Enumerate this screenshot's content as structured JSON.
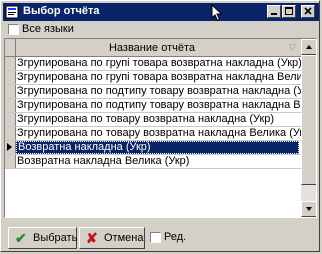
{
  "window": {
    "title": "Выбор отчёта",
    "title_color": "#0a246a"
  },
  "options": {
    "all_languages_label": "Все языки",
    "all_languages_checked": false
  },
  "grid": {
    "column_header": "Название отчёта",
    "rows": [
      "Згрупирована по групі товара возвратна накладна (Укр)",
      "Згрупирована по групі товара возвратна накладна Велика (Укр)",
      "Згрупирована по подтипу товару возвратна накладна (Укр)",
      "Згрупирована по подтипу товару возвратна накладна Велика (Укр)",
      "Згрупирована по товару возвратна накладна (Укр)",
      "Згрупирована по товару возвратна накладна Велика (Укр)",
      "Возвратна накладна (Укр)",
      "Возвратна накладна Велика (Укр)"
    ],
    "selected_row": "Возвратна накладна (Укр)",
    "selection_color": "#0a246a"
  },
  "buttons": {
    "ok_label": "Выбрать",
    "cancel_label": "Отмена"
  },
  "edit_option": {
    "label": "Ред.",
    "checked": false
  },
  "icons": {
    "app": "report-icon",
    "ok": "checkmark-icon",
    "cancel": "cross-icon",
    "filter": "filter-icon"
  }
}
